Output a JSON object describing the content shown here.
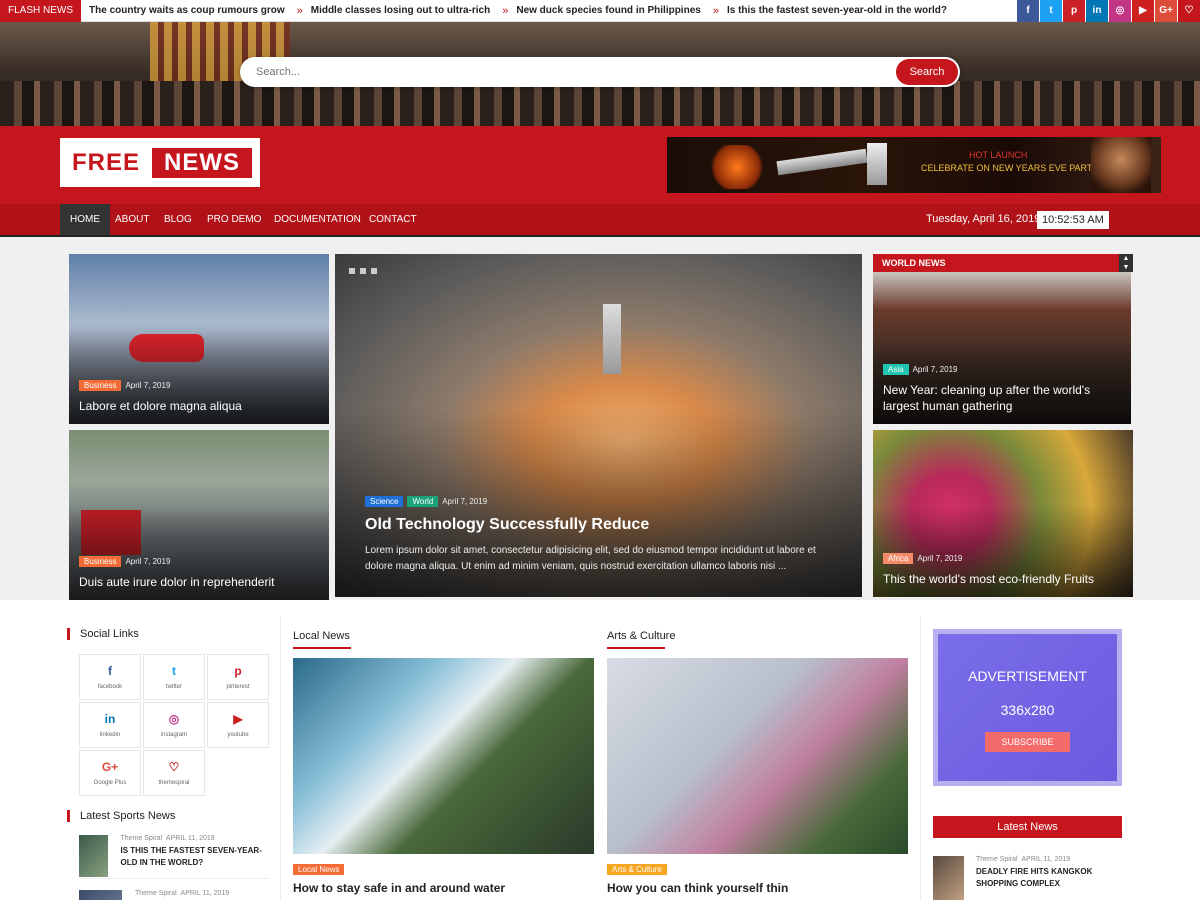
{
  "topbar": {
    "flash_label": "FLASH NEWS",
    "ticker": [
      "The country waits as coup rumours grow",
      "Middle classes losing out to ultra-rich",
      "New duck species found in Philippines",
      "Is this the fastest seven-year-old in the world?"
    ],
    "social_icons": [
      {
        "name": "facebook",
        "glyph": "f",
        "color": "#3b5998"
      },
      {
        "name": "twitter",
        "glyph": "t",
        "color": "#1da1f2"
      },
      {
        "name": "pinterest",
        "glyph": "p",
        "color": "#cb2027"
      },
      {
        "name": "linkedin",
        "glyph": "in",
        "color": "#0077b5"
      },
      {
        "name": "instagram",
        "glyph": "◎",
        "color": "#c13584"
      },
      {
        "name": "youtube",
        "glyph": "▶",
        "color": "#cd201f"
      },
      {
        "name": "google-plus",
        "glyph": "G+",
        "color": "#dd4b39"
      },
      {
        "name": "heart",
        "glyph": "♡",
        "color": "#c4161c"
      }
    ]
  },
  "search": {
    "placeholder": "Search...",
    "button": "Search"
  },
  "header": {
    "logo_word1": "FREE",
    "logo_word2": "NEWS",
    "ad": {
      "line1": "HOT LAUNCH",
      "line2": "CELEBRATE ON NEW YEARS EVE PARTY"
    }
  },
  "nav": {
    "items": [
      "HOME",
      "ABOUT",
      "BLOG",
      "PRO DEMO",
      "DOCUMENTATION",
      "CONTACT"
    ],
    "date": "Tuesday, April 16, 2019",
    "time": "10:52:53 AM"
  },
  "featured": {
    "left_top": {
      "tag": "Business",
      "date": "April 7, 2019",
      "title": "Labore et dolore magna aliqua"
    },
    "left_bottom": {
      "tag": "Business",
      "date": "April 7, 2019",
      "title": "Duis aute irure dolor in reprehenderit"
    },
    "main": {
      "tags": [
        "Science",
        "World"
      ],
      "date": "April 7, 2019",
      "title": "Old Technology Successfully Reduce",
      "excerpt": "Lorem ipsum dolor sit amet, consectetur adipisicing elit, sed do eiusmod tempor incididunt ut labore et dolore magna aliqua. Ut enim ad minim veniam, quis nostrud exercitation ullamco laboris nisi ..."
    },
    "world_news": {
      "heading": "WORLD NEWS",
      "items": [
        {
          "tag": "Asia",
          "date": "April 7, 2019",
          "title": "New Year: cleaning up after the world's largest human gathering"
        },
        {
          "tag": "Africa",
          "date": "April 7, 2019",
          "title": "This the world's most eco-friendly Fruits"
        }
      ]
    }
  },
  "sidebar_left": {
    "social_title": "Social Links",
    "social": [
      {
        "label": "facebook",
        "glyph": "f",
        "color": "#3b5998"
      },
      {
        "label": "twitter",
        "glyph": "t",
        "color": "#1da1f2"
      },
      {
        "label": "pinterest",
        "glyph": "p",
        "color": "#cb2027"
      },
      {
        "label": "linkedin",
        "glyph": "in",
        "color": "#0077b5"
      },
      {
        "label": "instagram",
        "glyph": "◎",
        "color": "#c13584"
      },
      {
        "label": "youtube",
        "glyph": "▶",
        "color": "#cd201f"
      },
      {
        "label": "Google Plus",
        "glyph": "G+",
        "color": "#dd4b39"
      },
      {
        "label": "themespiral",
        "glyph": "♡",
        "color": "#c4161c"
      }
    ],
    "sports_title": "Latest Sports News",
    "sports": [
      {
        "author": "Theme Spiral",
        "date": "APRIL 11, 2019",
        "title": "Is this the fastest seven-year-old in the world?"
      },
      {
        "author": "Theme Spiral",
        "date": "APRIL 11, 2019",
        "title": ""
      }
    ]
  },
  "middle": {
    "local": {
      "heading": "Local News",
      "tag": "Local News",
      "title": "How to stay safe in and around water"
    },
    "arts": {
      "heading": "Arts & Culture",
      "tag": "Arts & Culture",
      "title": "How you can think yourself thin"
    }
  },
  "sidebar_right": {
    "ad": {
      "line1": "ADVERTISEMENT",
      "line2": "336x280",
      "button": "SUBSCRIBE"
    },
    "latest_title": "Latest News",
    "latest": [
      {
        "author": "Theme Spiral",
        "date": "APRIL 11, 2019",
        "title": "Deadly fire hits Kangkok shopping complex"
      }
    ]
  },
  "colors": {
    "accent": "#c4161c",
    "nav": "#b01218",
    "business": "#f36b35",
    "science": "#1f6fd6",
    "world": "#1aa37a",
    "asia": "#21c6b0",
    "africa": "#f38b6b",
    "arts": "#f5a623"
  }
}
